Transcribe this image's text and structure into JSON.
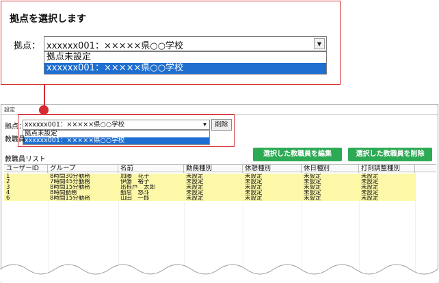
{
  "callout": {
    "title": "拠点を選択します",
    "label": "拠点：",
    "selected_value": "xxxxxx001：×××××県○○学校",
    "options": [
      "拠点未設定",
      "xxxxxx001：×××××県○○学校"
    ]
  },
  "window": {
    "title": "設定",
    "base_label": "拠点：",
    "selected_value": "xxxxxx001：×××××県○○学校",
    "options": [
      "拠点未設定",
      "xxxxxx001：×××××県○○学校"
    ],
    "delete_label": "削除",
    "staff_label": "教職員"
  },
  "buttons": {
    "edit_selected": "選択した教職員を編集",
    "delete_selected": "選択した教職員を削除"
  },
  "colors": {
    "accent_red": "#d62b30",
    "button_green": "#2daa54",
    "row_yellow": "#fdf8a8",
    "selection_blue": "#1f6fd1"
  },
  "list": {
    "title": "教職員リスト",
    "columns": [
      "ユーザーID",
      "グループ",
      "名前",
      "勤務種別",
      "休憩種別",
      "休日種別",
      "打刻調整種別"
    ],
    "rows": [
      [
        "1",
        "8時間30分勤務",
        "加藤　花子",
        "未設定",
        "未設定",
        "未設定",
        "未設定"
      ],
      [
        "2",
        "7時間45分勤務",
        "伊藤　裕子",
        "未設定",
        "未設定",
        "未設定",
        "未設定"
      ],
      [
        "3",
        "8時間15分勤務",
        "出根戸　太郎",
        "未設定",
        "未設定",
        "未設定",
        "未設定"
      ],
      [
        "4",
        "8時間勤務",
        "勤怠　悠斗",
        "未設定",
        "未設定",
        "未設定",
        "未設定"
      ],
      [
        "6",
        "8時間15分勤務",
        "山田　一郎",
        "未設定",
        "未設定",
        "未設定",
        "未設定"
      ]
    ]
  }
}
